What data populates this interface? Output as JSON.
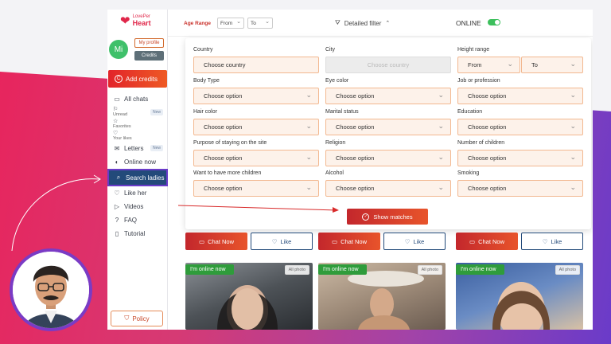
{
  "app": {
    "logo_line1": "LovePer",
    "logo_line2": "Heart",
    "avatar_initials": "Mi",
    "my_profile": "My profile",
    "credits": "Credits",
    "add_credits": "Add credits",
    "policy": "Policy"
  },
  "nav": [
    {
      "label": "All chats",
      "icon": "chat-icon"
    },
    {
      "label": "Unread",
      "icon": "flag-icon",
      "badge": "New"
    },
    {
      "label": "Favorites",
      "icon": "star-icon"
    },
    {
      "label": "Your likes",
      "icon": "heart-icon"
    },
    {
      "label": "Letters",
      "icon": "mail-icon",
      "badge": "New"
    },
    {
      "label": "Online now",
      "icon": "toggle-icon"
    },
    {
      "label": "Search ladies",
      "icon": "search-icon"
    },
    {
      "label": "Like her",
      "icon": "heart-icon"
    },
    {
      "label": "Videos",
      "icon": "video-icon"
    },
    {
      "label": "FAQ",
      "icon": "question-icon"
    },
    {
      "label": "Tutorial",
      "icon": "book-icon"
    }
  ],
  "topbar": {
    "age_range": "Age Range",
    "from": "From",
    "to": "To",
    "detailed_filter": "Detailed filter",
    "online": "ONLINE"
  },
  "filters": [
    {
      "label": "Country",
      "value": "Choose country"
    },
    {
      "label": "City",
      "value": "Choose country",
      "disabled": true
    },
    {
      "label": "Height range",
      "from": "From",
      "to": "To"
    },
    {
      "label": "Body Type",
      "value": "Choose option"
    },
    {
      "label": "Eye color",
      "value": "Choose option"
    },
    {
      "label": "Job or profession",
      "value": "Choose option"
    },
    {
      "label": "Hair color",
      "value": "Choose option"
    },
    {
      "label": "Marital status",
      "value": "Choose option"
    },
    {
      "label": "Education",
      "value": "Choose option"
    },
    {
      "label": "Purpose of staying on the site",
      "value": "Choose option"
    },
    {
      "label": "Religion",
      "value": "Choose option"
    },
    {
      "label": "Number of children",
      "value": "Choose option"
    },
    {
      "label": "Want to have more children",
      "value": "Choose option"
    },
    {
      "label": "Alcohol",
      "value": "Choose option"
    },
    {
      "label": "Smoking",
      "value": "Choose option"
    }
  ],
  "show_matches": "Show matches",
  "cards": {
    "chat_now": "Chat Now",
    "like": "Like",
    "online_badge": "I'm online now",
    "all_photo": "All photo"
  },
  "colors": {
    "accent_red": "#e2242a",
    "nav_active": "#234a7a",
    "online_green": "#2f9c3b"
  }
}
